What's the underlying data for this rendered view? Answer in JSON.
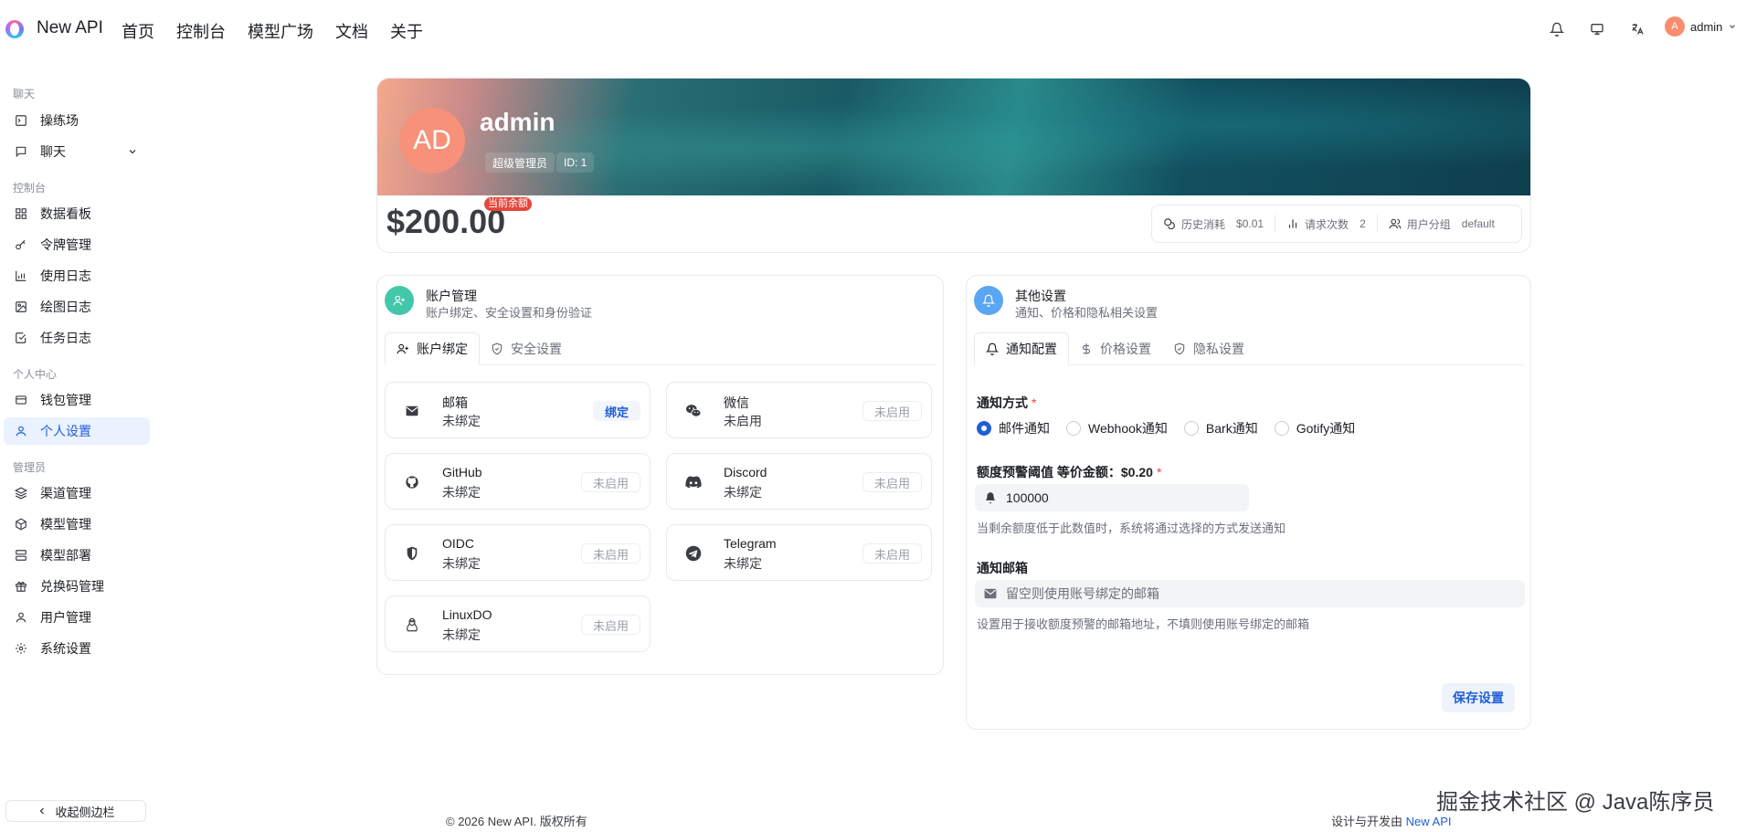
{
  "header": {
    "brand": "New API",
    "nav": [
      "首页",
      "控制台",
      "模型广场",
      "文档",
      "关于"
    ],
    "user_initial": "A",
    "user_name": "admin"
  },
  "sidebar": {
    "groups": [
      "聊天",
      "控制台",
      "个人中心",
      "管理员"
    ],
    "chat_items": [
      "操练场",
      "聊天"
    ],
    "console_items": [
      "数据看板",
      "令牌管理",
      "使用日志",
      "绘图日志",
      "任务日志"
    ],
    "personal_items": [
      "钱包管理",
      "个人设置"
    ],
    "admin_items": [
      "渠道管理",
      "模型管理",
      "模型部署",
      "兑换码管理",
      "用户管理",
      "系统设置"
    ],
    "active": "个人设置",
    "collapse_label": "收起侧边栏"
  },
  "profile": {
    "avatar_initials": "AD",
    "name": "admin",
    "role_tag": "超级管理员",
    "id_tag": "ID: 1",
    "balance": "$200.00",
    "balance_badge": "当前余额",
    "stats": [
      {
        "label": "历史消耗",
        "value": "$0.01",
        "icon": "coins-icon"
      },
      {
        "label": "请求次数",
        "value": "2",
        "icon": "bar-chart-icon"
      },
      {
        "label": "用户分组",
        "value": "default",
        "icon": "users-icon"
      }
    ]
  },
  "account": {
    "title": "账户管理",
    "subtitle": "账户绑定、安全设置和身份验证",
    "tabs": [
      "账户绑定",
      "安全设置"
    ],
    "bindings": [
      {
        "name": "邮箱",
        "status": "未绑定",
        "button": "绑定",
        "icon": "mail-icon"
      },
      {
        "name": "微信",
        "status": "未启用",
        "button": "未启用",
        "icon": "wechat-icon"
      },
      {
        "name": "GitHub",
        "status": "未绑定",
        "button": "未启用",
        "icon": "github-icon"
      },
      {
        "name": "Discord",
        "status": "未绑定",
        "button": "未启用",
        "icon": "discord-icon"
      },
      {
        "name": "OIDC",
        "status": "未绑定",
        "button": "未启用",
        "icon": "shield-icon"
      },
      {
        "name": "Telegram",
        "status": "未绑定",
        "button": "未启用",
        "icon": "telegram-icon"
      },
      {
        "name": "LinuxDO",
        "status": "未绑定",
        "button": "未启用",
        "icon": "penguin-icon"
      }
    ]
  },
  "other": {
    "title": "其他设置",
    "subtitle": "通知、价格和隐私相关设置",
    "tabs": [
      "通知配置",
      "价格设置",
      "隐私设置"
    ],
    "notify_label": "通知方式",
    "notify_options": [
      "邮件通知",
      "Webhook通知",
      "Bark通知",
      "Gotify通知"
    ],
    "notify_selected": "邮件通知",
    "threshold_label": "额度预警阈值 等价金额：$0.20",
    "threshold_value": "100000",
    "threshold_hint": "当剩余额度低于此数值时，系统将通过选择的方式发送通知",
    "email_label": "通知邮箱",
    "email_placeholder": "留空则使用账号绑定的邮箱",
    "email_hint": "设置用于接收额度预警的邮箱地址，不填则使用账号绑定的邮箱",
    "save_label": "保存设置"
  },
  "footer": {
    "copyright": "© 2026 New API. 版权所有",
    "credit_prefix": "设计与开发由",
    "credit_link": "New API",
    "watermark": "掘金技术社区 @ Java陈序员"
  },
  "colors": {
    "accent": "#1f5fd6",
    "avatar": "#f7917a",
    "badge": "#e6453a"
  }
}
